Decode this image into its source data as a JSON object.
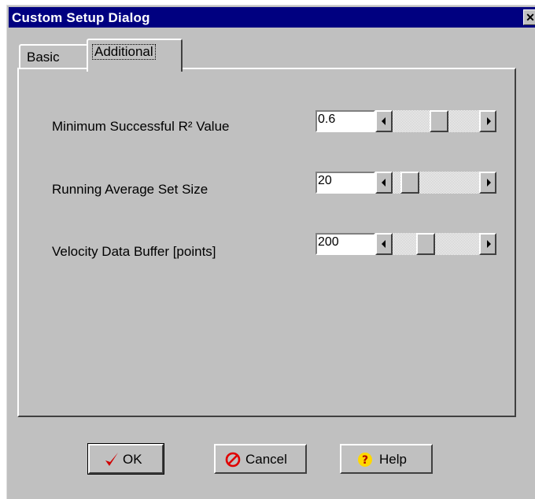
{
  "window": {
    "title": "Custom Setup Dialog",
    "close_glyph": "✕"
  },
  "tabs": [
    {
      "label": "Basic",
      "active": false
    },
    {
      "label": "Additional",
      "active": true
    }
  ],
  "settings": [
    {
      "label": "Minimum Successful R² Value",
      "value": "0.6",
      "slider_position": 0.55
    },
    {
      "label": "Running Average Set Size",
      "value": "20",
      "slider_position": 0.12
    },
    {
      "label": "Velocity Data Buffer [points]",
      "value": "200",
      "slider_position": 0.35
    }
  ],
  "buttons": {
    "ok_label": "OK",
    "cancel_label": "Cancel",
    "help_label": "Help"
  },
  "icons": {
    "ok": "checkmark-icon",
    "cancel": "no-entry-icon",
    "help": "question-icon"
  },
  "colors": {
    "titlebar": "#000080",
    "face": "#c0c0c0",
    "ok_check": "#d00000",
    "cancel_icon": "#e00000",
    "help_icon": "#ffd800"
  }
}
